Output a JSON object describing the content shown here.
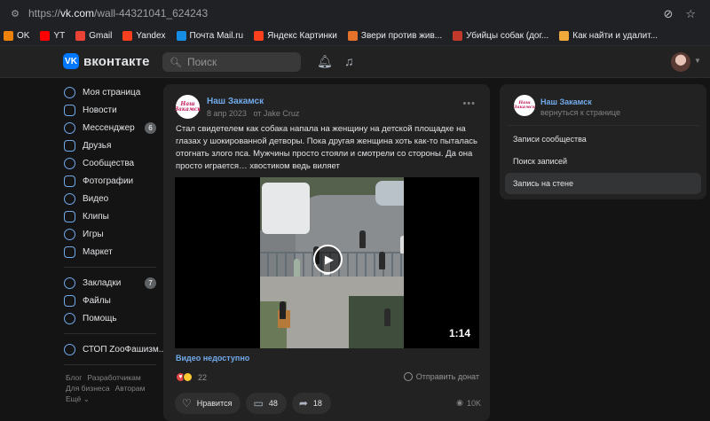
{
  "browser": {
    "url_prefix": "https://",
    "url_host": "vk.com",
    "url_path": "/wall-44321041_624243",
    "bookmarks": [
      {
        "label": "OK",
        "color": "#ee8208"
      },
      {
        "label": "YT",
        "color": "#ff0000"
      },
      {
        "label": "Gmail",
        "color": "#ea4335"
      },
      {
        "label": "Yandex",
        "color": "#fc3f1d"
      },
      {
        "label": "Почта Mail.ru",
        "color": "#168de2"
      },
      {
        "label": "Яндекс Картинки",
        "color": "#fc3f1d"
      },
      {
        "label": "Звери против жив...",
        "color": "#e3722b"
      },
      {
        "label": "Убийцы собак (дог...",
        "color": "#c0392b"
      },
      {
        "label": "Как найти и удалит...",
        "color": "#f2a93b"
      }
    ]
  },
  "header": {
    "brand": "вконтакте",
    "logo_letter": "VK",
    "search_placeholder": "Поиск"
  },
  "sidebar": {
    "items": [
      {
        "label": "Моя страница",
        "icon": "user-circle-icon",
        "badge": ""
      },
      {
        "label": "Новости",
        "icon": "news-icon",
        "badge": ""
      },
      {
        "label": "Мессенджер",
        "icon": "message-icon",
        "badge": "6"
      },
      {
        "label": "Друзья",
        "icon": "friends-icon",
        "badge": ""
      },
      {
        "label": "Сообщества",
        "icon": "groups-icon",
        "badge": ""
      },
      {
        "label": "Фотографии",
        "icon": "photo-icon",
        "badge": ""
      },
      {
        "label": "Видео",
        "icon": "video-icon",
        "badge": ""
      },
      {
        "label": "Клипы",
        "icon": "clips-icon",
        "badge": ""
      },
      {
        "label": "Игры",
        "icon": "gamepad-icon",
        "badge": ""
      },
      {
        "label": "Маркет",
        "icon": "cart-icon",
        "badge": ""
      }
    ],
    "items2": [
      {
        "label": "Закладки",
        "icon": "bookmark-icon",
        "badge": "7"
      },
      {
        "label": "Файлы",
        "icon": "file-icon",
        "badge": ""
      },
      {
        "label": "Помощь",
        "icon": "help-icon",
        "badge": ""
      }
    ],
    "items3": [
      {
        "label": "СТОП ZooФашизм...",
        "icon": "community-icon",
        "badge": ""
      }
    ],
    "footer": {
      "blog": "Блог",
      "developers": "Разработчикам",
      "business": "Для бизнеса",
      "authors": "Авторам",
      "more": "Ещё ⌄"
    }
  },
  "post": {
    "author": "Наш Закамск",
    "avatar_text": "Наш Закамск",
    "date": "8 апр 2023",
    "from": "от Jake Cruz",
    "text": "Стал свидетелем как собака напала на женщину на детской площадке на глазах у шокированной детворы. Пока другая женщина хоть как-то пыталась отогнать злого пса. Мужчины просто стояли и смотрели со стороны. Да она просто играется… хвостиком ведь виляет",
    "video_duration": "1:14",
    "video_unavailable": "Видео недоступно",
    "reactions_count": "22",
    "send_donut": "Отправить донат",
    "like_label": "Нравится",
    "comments_count": "48",
    "shares_count": "18",
    "views": "10K"
  },
  "right_panel": {
    "name": "Наш Закамск",
    "back": "вернуться к странице",
    "items": [
      {
        "label": "Записи сообщества",
        "active": false
      },
      {
        "label": "Поиск записей",
        "active": false
      },
      {
        "label": "Запись на стене",
        "active": true
      }
    ]
  }
}
